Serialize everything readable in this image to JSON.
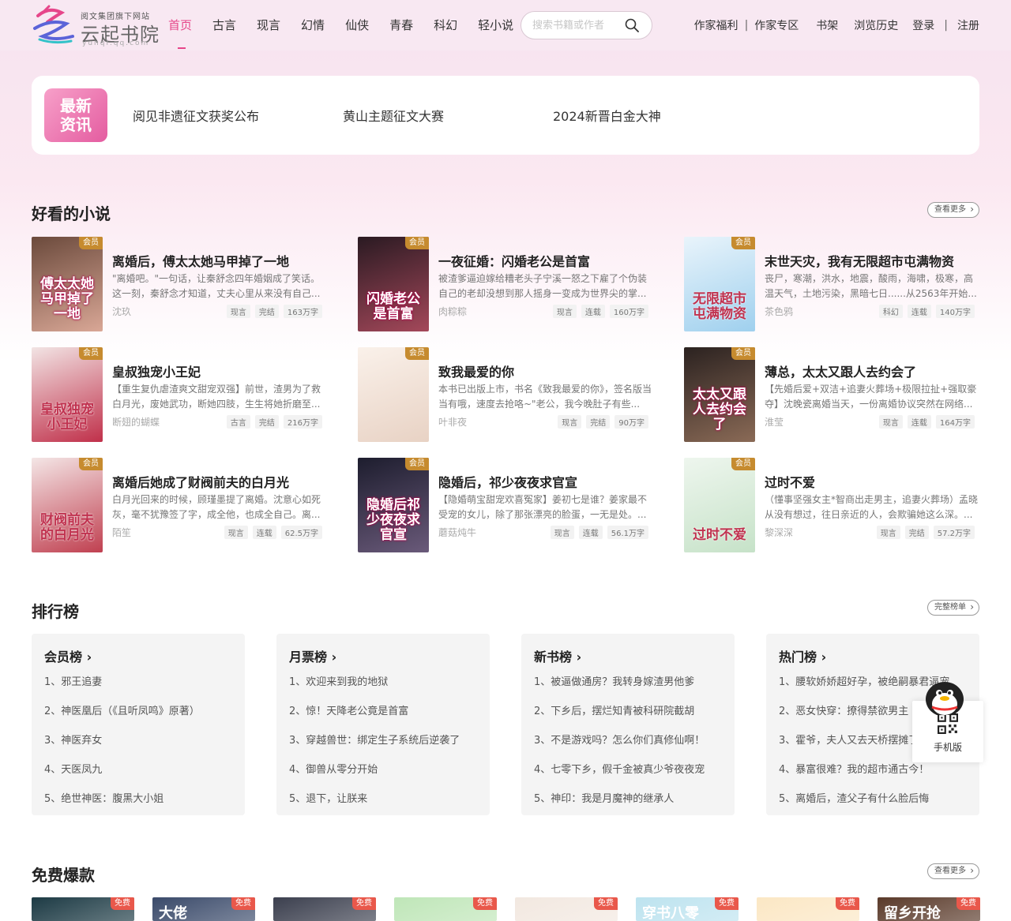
{
  "header": {
    "logo_small": "阅文集团旗下网站",
    "logo_name": "云起书院",
    "logo_url": "yunqi.qq.com",
    "nav": [
      "首页",
      "古言",
      "现言",
      "幻情",
      "仙侠",
      "青春",
      "科幻",
      "轻小说"
    ],
    "search_placeholder": "搜索书籍或作者",
    "links": {
      "author_benefits": "作家福利",
      "author_zone": "作家专区",
      "bookshelf": "书架",
      "history": "浏览历史",
      "login": "登录",
      "register": "注册"
    }
  },
  "news": {
    "badge": "最新资讯",
    "items": [
      "阅见非遗征文获奖公布",
      "黄山主题征文大赛",
      "2024新晋白金大神"
    ]
  },
  "good_novels": {
    "title": "好看的小说",
    "more": "查看更多",
    "books": [
      {
        "title": "离婚后，傅太太她马甲掉了一地",
        "desc": "\"离婚吧。\"一句话，让秦舒念四年婚姻成了笑话。这一刻，秦舒念才知道，丈夫心里从来没有自己...",
        "author": "沈玖",
        "tags": [
          "现言",
          "完结",
          "163万字"
        ],
        "badge": "会员",
        "cover_text": "傅太太她马甲掉了一地",
        "colors": [
          "#6b4a3c",
          "#d9a796"
        ]
      },
      {
        "title": "一夜征婚：闪婚老公是首富",
        "desc": "被渣爹逼迫嫁给糟老头子宁溪一怒之下雇了个伪装自己的老却没想到那人摇身一变成为世界尖的掌...",
        "author": "肉粽粽",
        "tags": [
          "现言",
          "连载",
          "160万字"
        ],
        "badge": "会员",
        "cover_text": "闪婚老公是首富",
        "colors": [
          "#2a1a22",
          "#a4485a"
        ]
      },
      {
        "title": "末世天灾，我有无限超市屯满物资",
        "desc": "丧尸，寒潮，洪水，地震，酸雨，海啸，极寒，高温天气，土地污染，黑暗七日......从2563年开始...",
        "author": "茶色鸦",
        "tags": [
          "科幻",
          "连载",
          "140万字"
        ],
        "badge": "会员",
        "cover_text": "无限超市屯满物资",
        "colors": [
          "#e9f4fb",
          "#9fd0ee"
        ]
      },
      {
        "title": "皇叔独宠小王妃",
        "desc": "【重生复仇虐渣爽文甜宠双强】前世，渣男为了救白月光，废她武功，断她四肢，生生将她折磨至...",
        "author": "断翅的蝴蝶",
        "tags": [
          "古言",
          "完结",
          "216万字"
        ],
        "badge": "会员",
        "cover_text": "皇叔独宠小王妃",
        "colors": [
          "#f2e4e4",
          "#c0304a"
        ]
      },
      {
        "title": "致我最爱的你",
        "desc": "本书已出版上市，书名《致我最爱的你》，签名版当当有哦，速度去抢咯~\"老公，我今晚肚子有些...",
        "author": "叶非夜",
        "tags": [
          "现言",
          "完结",
          "90万字"
        ],
        "badge": "会员",
        "cover_text": "",
        "colors": [
          "#faf1ea",
          "#e8d2c4"
        ]
      },
      {
        "title": "薄总，太太又跟人去约会了",
        "desc": "【先婚后爱+双洁+追妻火葬场+极限拉扯+强取豪夺】沈晚瓷离婚当天，一份离婚协议突然在网络...",
        "author": "淮莹",
        "tags": [
          "现言",
          "连载",
          "164万字"
        ],
        "badge": "会员",
        "cover_text": "太太又跟人去约会了",
        "colors": [
          "#2b2220",
          "#8a6a56"
        ]
      },
      {
        "title": "离婚后她成了财阀前夫的白月光",
        "desc": "白月光回来的时候，顾瑾墨提了离婚。沈意心如死灰，毫不犹豫签了字，成全他，也成全自己。离...",
        "author": "陌笙",
        "tags": [
          "现言",
          "连载",
          "62.5万字"
        ],
        "badge": "会员",
        "cover_text": "财阀前夫的白月光",
        "colors": [
          "#f4e6e6",
          "#c04050"
        ]
      },
      {
        "title": "隐婚后，祁少夜夜求官宣",
        "desc": "【隐婚萌宝甜宠欢喜冤家】姜初七是谁？姜家最不受宠的女儿，除了那张漂亮的脸蛋，一无是处。...",
        "author": "蘑菇炖牛",
        "tags": [
          "现言",
          "连载",
          "56.1万字"
        ],
        "badge": "会员",
        "cover_text": "隐婚后祁少夜夜求官宣",
        "colors": [
          "#1d1d2e",
          "#6a5a7a"
        ]
      },
      {
        "title": "过时不爱",
        "desc": "（懂事坚强女主*智商出走男主，追妻火葬场）孟晓从没有想过，往日亲近的人，会欺骗她这么深。...",
        "author": "黎深深",
        "tags": [
          "现言",
          "完结",
          "57.2万字"
        ],
        "badge": "会员",
        "cover_text": "过时不爱",
        "colors": [
          "#eef6ee",
          "#c6e2c8"
        ]
      }
    ]
  },
  "ranking": {
    "title": "排行榜",
    "more": "完整榜单",
    "boards": [
      {
        "name": "会员榜",
        "items": [
          "1、邪王追妻",
          "2、神医凰后（《且听凤鸣》原著）",
          "3、神医弃女",
          "4、天医凤九",
          "5、绝世神医：腹黑大小姐"
        ]
      },
      {
        "name": "月票榜",
        "items": [
          "1、欢迎来到我的地狱",
          "2、惊！天降老公竟是首富",
          "3、穿越兽世：绑定生子系统后逆袭了",
          "4、御兽从零分开始",
          "5、退下，让朕来"
        ]
      },
      {
        "name": "新书榜",
        "items": [
          "1、被逼做通房？我转身嫁渣男他爹",
          "2、下乡后，摆烂知青被科研院截胡",
          "3、不是游戏吗？怎么你们真修仙啊！",
          "4、七零下乡，假千金被真少爷夜夜宠",
          "5、神印：我是月魔神的继承人"
        ]
      },
      {
        "name": "热门榜",
        "items": [
          "1、腰软娇娇超好孕，被绝嗣暴君逼宠",
          "2、恶女快穿：撩得禁欲男主",
          "3、霍爷，夫人又去天桥摆摊了",
          "4、暴富很难？我的超市通古今！",
          "5、离婚后，渣父子有什么脸后悔"
        ]
      }
    ]
  },
  "float": {
    "label": "手机版"
  },
  "free": {
    "title": "免费爆款",
    "more": "查看更多",
    "badge": "免费",
    "cover_colors": [
      "#1c3a44",
      "#3a4a6a",
      "#3b3f4e",
      "#bfe6b8",
      "#f2e8e0",
      "#bde3ef",
      "#fbe7c4",
      "#5a3a2a"
    ],
    "cover_texts": [
      "",
      "大佬",
      "",
      "",
      "",
      "穿书八零",
      "",
      "留乡开抢"
    ]
  }
}
